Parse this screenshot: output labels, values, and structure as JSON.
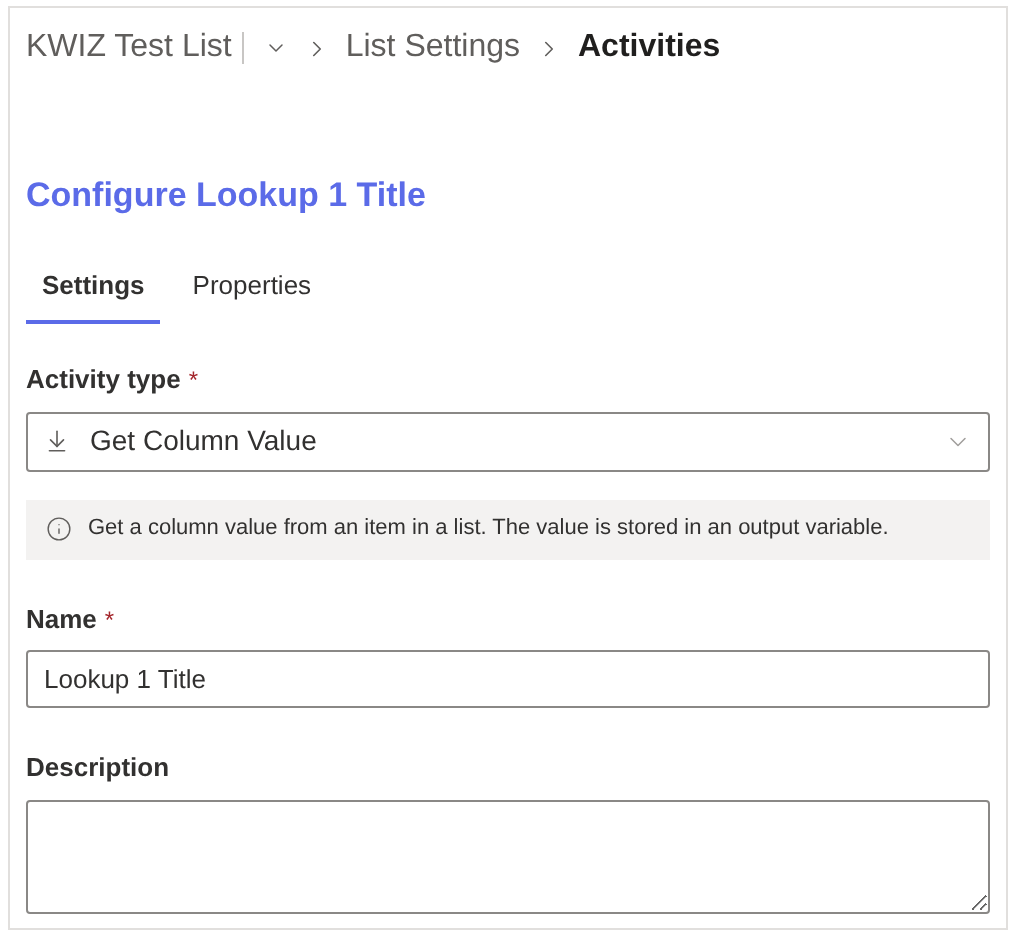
{
  "breadcrumb": {
    "items": [
      {
        "kind": "menu",
        "label": "KWIZ Test List",
        "current": false
      },
      {
        "kind": "link",
        "label": "List Settings",
        "current": false
      },
      {
        "kind": "link",
        "label": "Activities",
        "current": true
      }
    ]
  },
  "title": "Configure Lookup 1 Title",
  "tabs": [
    {
      "label": "Settings",
      "selected": true
    },
    {
      "label": "Properties",
      "selected": false
    }
  ],
  "fields": [
    {
      "kind": "select",
      "label": "Activity type",
      "required_mark": "*",
      "value": "Get Column Value",
      "info": "Get a column value from an item in a list. The value is stored in an output variable."
    },
    {
      "kind": "text",
      "label": "Name",
      "required_mark": "*",
      "value": "Lookup 1 Title"
    },
    {
      "kind": "textarea",
      "label": "Description"
    }
  ]
}
